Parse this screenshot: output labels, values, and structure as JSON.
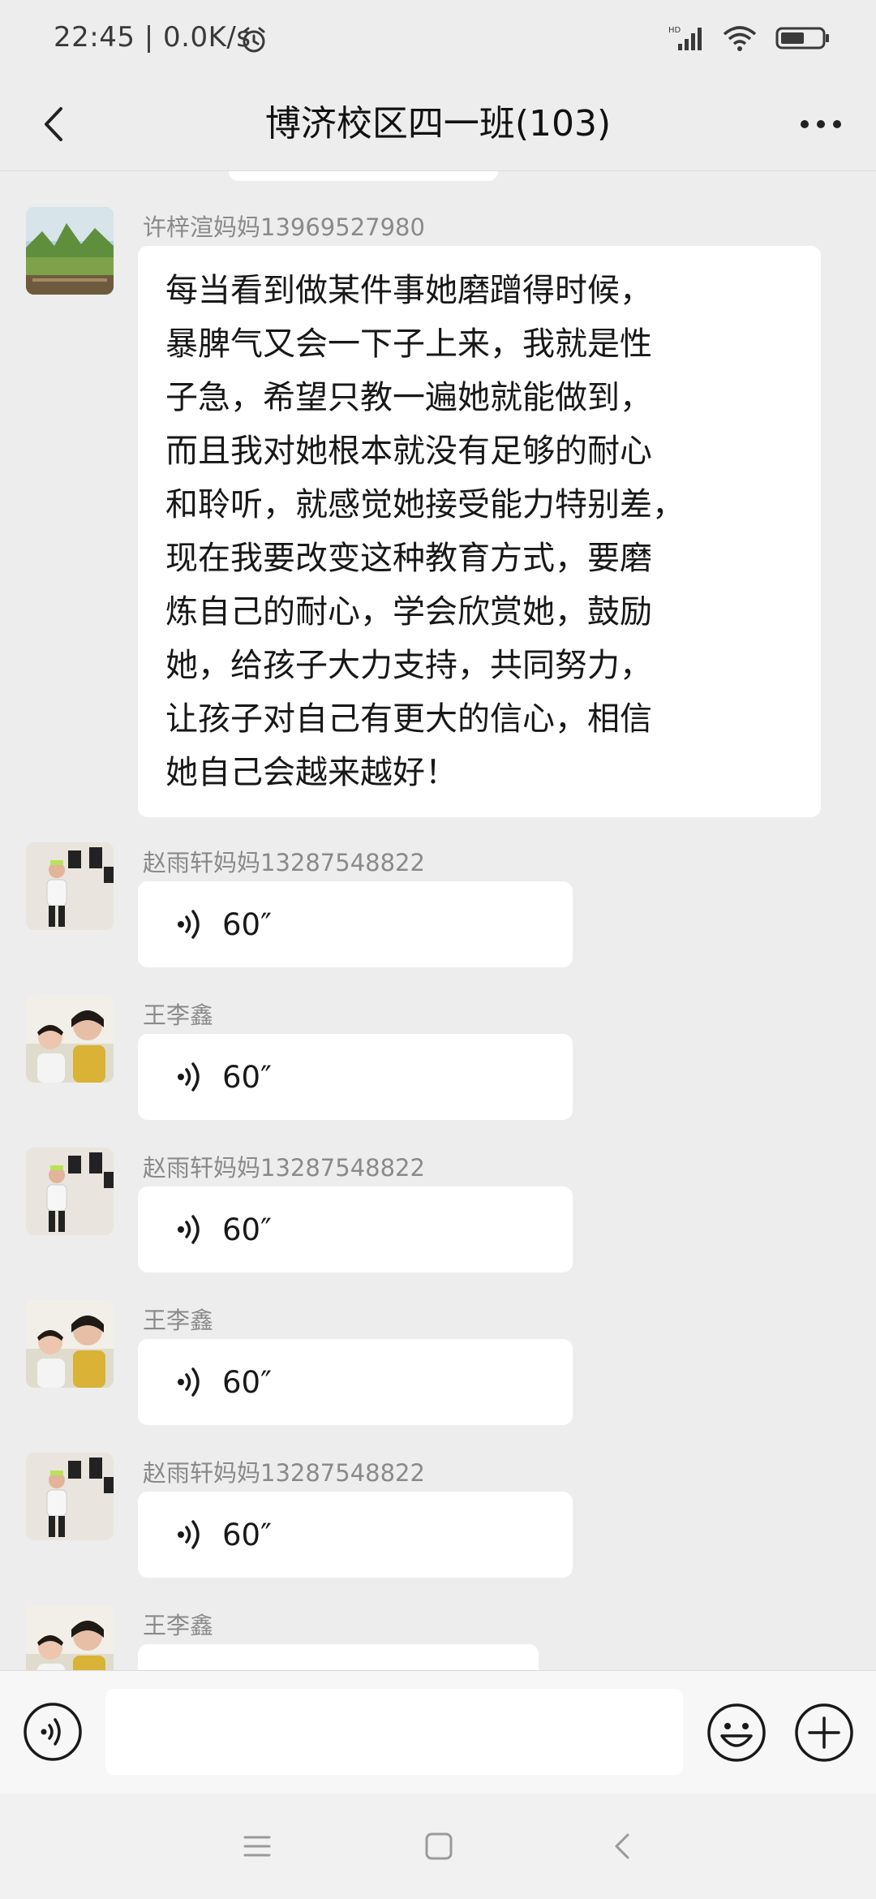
{
  "status_bar": {
    "time": "22:45 | 0.0K/s",
    "icons": [
      "alarm-icon",
      "hd-signal-icon",
      "wifi-icon",
      "battery-icon"
    ]
  },
  "header": {
    "title": "博济校区四一班(103)",
    "back_icon": "chevron-left-icon",
    "more_icon": "more-dots-icon"
  },
  "messages": [
    {
      "type": "text",
      "sender": "许梓渲妈妈13969527980",
      "lines": [
        "每当看到做某件事她磨蹭得时候，",
        "暴脾气又会一下子上来，我就是性",
        "子急，希望只教一遍她就能做到，",
        "而且我对她根本就没有足够的耐心",
        "和聆听，就感觉她接受能力特别差，",
        "现在我要改变这种教育方式，要磨",
        "炼自己的耐心，学会欣赏她，鼓励",
        "她，给孩子大力支持，共同努力，",
        "让孩子对自己有更大的信心，相信",
        "她自己会越来越好！"
      ]
    },
    {
      "type": "voice",
      "sender": "赵雨轩妈妈13287548822",
      "duration": "60″"
    },
    {
      "type": "voice",
      "sender": "王李鑫",
      "duration": "60″"
    },
    {
      "type": "voice",
      "sender": "赵雨轩妈妈13287548822",
      "duration": "60″"
    },
    {
      "type": "voice",
      "sender": "王李鑫",
      "duration": "60″"
    },
    {
      "type": "voice",
      "sender": "赵雨轩妈妈13287548822",
      "duration": "60″"
    },
    {
      "type": "partial",
      "sender": "王李鑫"
    }
  ],
  "input_bar": {
    "voice_icon": "voice-input-icon",
    "text_value": "",
    "emoji_icon": "emoji-icon",
    "plus_icon": "plus-icon"
  },
  "nav_bar": {
    "icons": [
      "menu-icon",
      "home-square-icon",
      "back-triangle-icon"
    ]
  },
  "colors": {
    "background": "#ededed",
    "bubble": "#ffffff",
    "sender_name": "#8a8a8a"
  }
}
